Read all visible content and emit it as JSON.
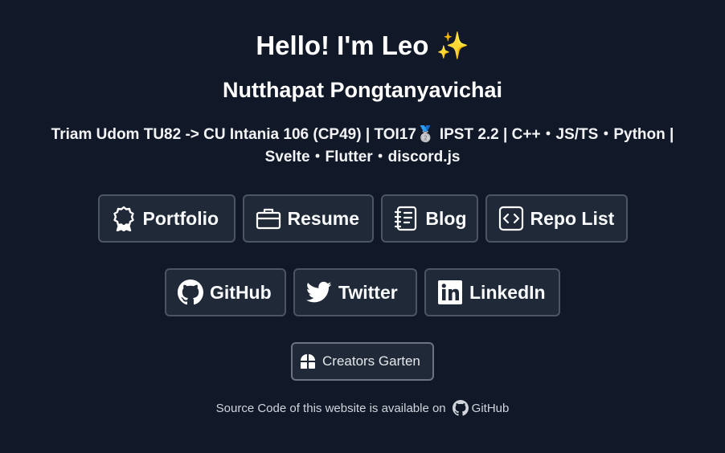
{
  "header": {
    "title": "Hello! I'm Leo ✨",
    "name": "Nutthapat Pongtanyavichai",
    "tagline_line1": "Triam Udom TU82 -> CU Intania 106 (CP49) | TOI17🥈 IPST 2.2 | C++・JS/TS・Python |",
    "tagline_line2": "Svelte・Flutter・discord.js"
  },
  "links_primary": [
    {
      "label": "Portfolio",
      "icon": "award-icon"
    },
    {
      "label": "Resume",
      "icon": "briefcase-icon"
    },
    {
      "label": "Blog",
      "icon": "notebook-icon"
    },
    {
      "label": "Repo List",
      "icon": "code-icon"
    }
  ],
  "links_social": [
    {
      "label": "GitHub",
      "icon": "github-icon"
    },
    {
      "label": "Twitter",
      "icon": "twitter-icon"
    },
    {
      "label": "LinkedIn",
      "icon": "linkedin-icon"
    }
  ],
  "creators": {
    "label": "Creators Garten",
    "icon": "creators-garten-icon"
  },
  "footer": {
    "text": "Source Code of this website is available on",
    "link_label": "GitHub",
    "link_icon": "github-icon"
  },
  "colors": {
    "background": "#111827",
    "button_bg": "#1f2937",
    "button_border": "#4b5563",
    "text": "#ffffff"
  }
}
